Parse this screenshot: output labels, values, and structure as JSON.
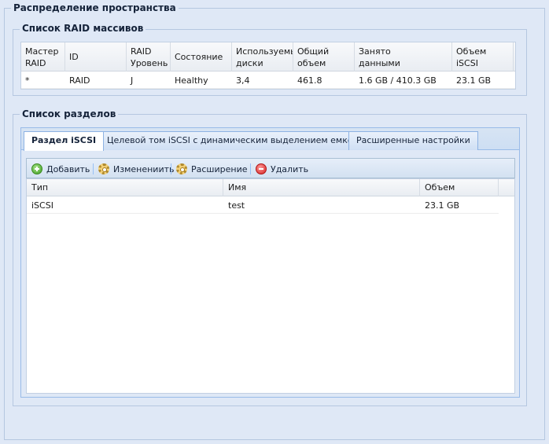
{
  "outer": {
    "title": "Распределение пространства"
  },
  "raid": {
    "title": "Список RAID массивов",
    "columns": [
      "Мастер RAID",
      "ID",
      "RAID Уровень",
      "Состояние",
      "Используемые диски",
      "Общий объем",
      "Занято данными",
      "Объем iSCSI"
    ],
    "column_lines": [
      [
        "Мастер",
        "RAID"
      ],
      [
        "ID",
        ""
      ],
      [
        "RAID",
        "Уровень"
      ],
      [
        "Состояние",
        ""
      ],
      [
        "Используемые",
        "диски"
      ],
      [
        "Общий",
        "объем"
      ],
      [
        "Занято",
        "данными"
      ],
      [
        "Объем",
        "iSCSI"
      ]
    ],
    "rows": [
      {
        "master": "*",
        "id": "RAID",
        "level": "J",
        "status": "Healthy",
        "disks": "3,4",
        "total": "461.8",
        "used": "1.6 GB / 410.3 GB",
        "iscsi": "23.1 GB"
      }
    ]
  },
  "partitions": {
    "title": "Список разделов",
    "tabs": [
      {
        "label": "Раздел iSCSI",
        "active": true
      },
      {
        "label": "Целевой том iSCSI с динамическим выделением емкости",
        "active": false
      },
      {
        "label": "Расширенные настройки",
        "active": false
      }
    ],
    "toolbar": {
      "add": "Добавить",
      "edit": "Изменениить",
      "expand": "Расширение",
      "delete": "Удалить"
    },
    "columns": {
      "type": "Тип",
      "name": "Имя",
      "size": "Объем"
    },
    "rows": [
      {
        "type": "iSCSI",
        "name": "test",
        "size": "23.1 GB"
      }
    ]
  }
}
